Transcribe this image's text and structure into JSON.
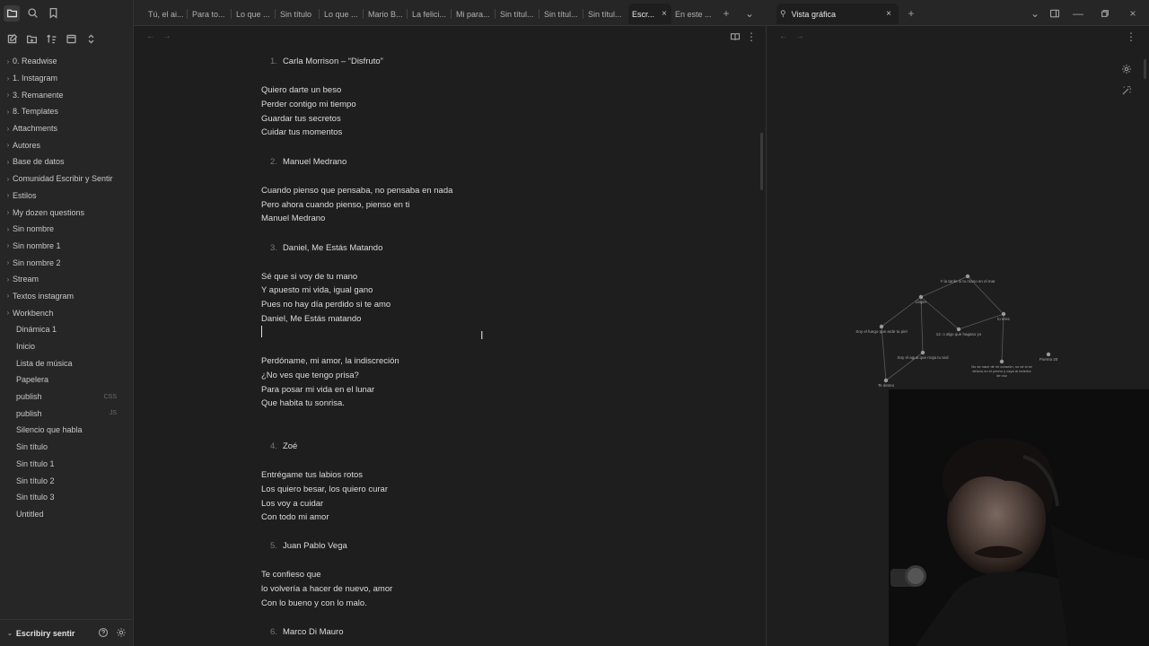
{
  "ribbon": {
    "top_icons": [
      "folder-icon",
      "search-icon",
      "bookmark-icon"
    ],
    "tools": [
      "new-note-icon",
      "new-folder-icon",
      "sort-icon",
      "collapse-icon",
      "expand-icon"
    ]
  },
  "explorer": {
    "items": [
      {
        "label": "0. Readwise",
        "folder": true
      },
      {
        "label": "1. Instagram",
        "folder": true
      },
      {
        "label": "3. Remanente",
        "folder": true
      },
      {
        "label": "8. Templates",
        "folder": true
      },
      {
        "label": "Attachments",
        "folder": true
      },
      {
        "label": "Autores",
        "folder": true
      },
      {
        "label": "Base de datos",
        "folder": true
      },
      {
        "label": "Comunidad Escribir y Sentir",
        "folder": true
      },
      {
        "label": "Estilos",
        "folder": true
      },
      {
        "label": "My dozen questions",
        "folder": true
      },
      {
        "label": "Sin nombre",
        "folder": true
      },
      {
        "label": "Sin nombre 1",
        "folder": true
      },
      {
        "label": "Sin nombre 2",
        "folder": true
      },
      {
        "label": "Stream",
        "folder": true
      },
      {
        "label": "Textos instagram",
        "folder": true
      },
      {
        "label": "Workbench",
        "folder": true
      },
      {
        "label": "Dinámica 1",
        "folder": false
      },
      {
        "label": "Inicio",
        "folder": false
      },
      {
        "label": "Lista de música",
        "folder": false
      },
      {
        "label": "Papelera",
        "folder": false
      },
      {
        "label": "publish",
        "folder": false,
        "ext": "CSS"
      },
      {
        "label": "publish",
        "folder": false,
        "ext": "JS"
      },
      {
        "label": "Silencio que habla",
        "folder": false
      },
      {
        "label": "Sin título",
        "folder": false
      },
      {
        "label": "Sin título 1",
        "folder": false
      },
      {
        "label": "Sin título 2",
        "folder": false
      },
      {
        "label": "Sin título 3",
        "folder": false
      },
      {
        "label": "Untitled",
        "folder": false
      }
    ],
    "vault_name": "Escribiry sentir"
  },
  "tabs": [
    {
      "label": "Tú, el ai..."
    },
    {
      "label": "Para to..."
    },
    {
      "label": "Lo que ..."
    },
    {
      "label": "Sin título"
    },
    {
      "label": "Lo que ..."
    },
    {
      "label": "Mario B..."
    },
    {
      "label": "La felici..."
    },
    {
      "label": "Mi para..."
    },
    {
      "label": "Sin títul..."
    },
    {
      "label": "Sin títul..."
    },
    {
      "label": "Sin títul..."
    },
    {
      "label": "Escr...",
      "active": true
    },
    {
      "label": "En este ..."
    }
  ],
  "graph_tab": {
    "label": "Vista gráfica"
  },
  "document": {
    "sections": [
      {
        "num": "1.",
        "heading": "Carla Morrison – “Disfruto”",
        "lines": [
          "Quiero darte un beso",
          "Perder contigo mi tiempo",
          "Guardar tus secretos",
          "Cuidar tus momentos"
        ]
      },
      {
        "num": "2.",
        "heading": "Manuel Medrano",
        "lines": [
          "Cuando pienso que pensaba, no pensaba en nada",
          "Pero ahora cuando pienso, pienso en ti",
          "Manuel Medrano"
        ]
      },
      {
        "num": "3.",
        "heading": "Daniel, Me Estás Matando",
        "lines": [
          "Sé que si voy de tu mano",
          "Y apuesto mi vida, igual gano",
          "Pues no hay día perdido si te amo",
          "Daniel, Me Estás matando"
        ]
      },
      {
        "num": "",
        "heading": "",
        "lines": [
          "Perdóname, mi amor, la indiscreción",
          "¿No ves que tengo prisa?",
          "Para posar mi vida en el lunar",
          "Que habita tu sonrisa."
        ]
      },
      {
        "num": "4.",
        "heading": "Zoé",
        "lines": [
          "Entrégame tus labios rotos",
          "Los quiero besar, los quiero curar",
          "Los voy a cuidar",
          "Con todo mi amor"
        ]
      },
      {
        "num": "5.",
        "heading": "Juan Pablo Vega",
        "lines": [
          "Te confieso que",
          "lo volvería a hacer de nuevo, amor",
          "Con lo bueno y con lo malo."
        ]
      },
      {
        "num": "6.",
        "heading": "Marco Di Mauro",
        "lines": []
      }
    ]
  },
  "graph": {
    "nodes": [
      {
        "label": "Y la tarde si tu mano en el mar"
      },
      {
        "label": "Llayer"
      },
      {
        "label": "lo eres"
      },
      {
        "label": "Soy el fuego que arde tu piel"
      },
      {
        "label": "12. o algo que hagaso yo"
      },
      {
        "label": "Soy el agua que moja tu sed"
      },
      {
        "label": "Poema 20"
      },
      {
        "label": "No se nace de mi corazón, no sé si se detuvo en el pecho y vaya al rededor de voz"
      },
      {
        "label": "Te deseo"
      }
    ],
    "link_color": "#5a5a5a",
    "node_color": "#9a9a9a"
  },
  "colors": {
    "accent": "#7f6df2",
    "bg": "#1e1e1e",
    "panel": "#262626"
  }
}
